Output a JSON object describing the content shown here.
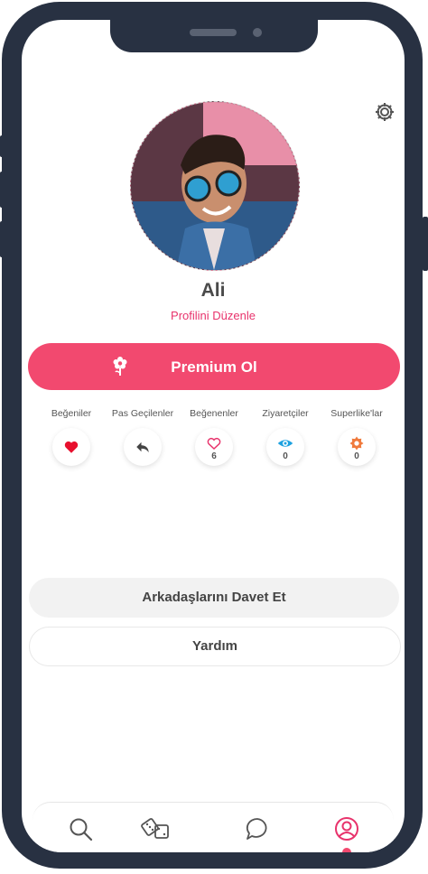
{
  "profile": {
    "name": "Ali",
    "edit_link": "Profilini Düzenle"
  },
  "premium": {
    "label": "Premium Ol",
    "color": "#f2496f"
  },
  "stats": [
    {
      "label": "Beğeniler",
      "icon": "heart-filled-icon",
      "count": ""
    },
    {
      "label": "Pas Geçilenler",
      "icon": "reply-arrow-icon",
      "count": ""
    },
    {
      "label": "Beğenenler",
      "icon": "heart-outline-icon",
      "count": "6"
    },
    {
      "label": "Ziyaretçiler",
      "icon": "eye-icon",
      "count": "0"
    },
    {
      "label": "Superlike'lar",
      "icon": "star-badge-icon",
      "count": "0"
    }
  ],
  "actions": {
    "invite_label": "Arkadaşlarını Davet Et",
    "help_label": "Yardım"
  },
  "tabbar": {
    "items": [
      "search-icon",
      "dice-icon",
      "chat-icon",
      "profile-icon"
    ],
    "active": "profile-icon"
  },
  "colors": {
    "accent": "#f2496f",
    "link": "#e8336c",
    "frame": "#283142"
  }
}
